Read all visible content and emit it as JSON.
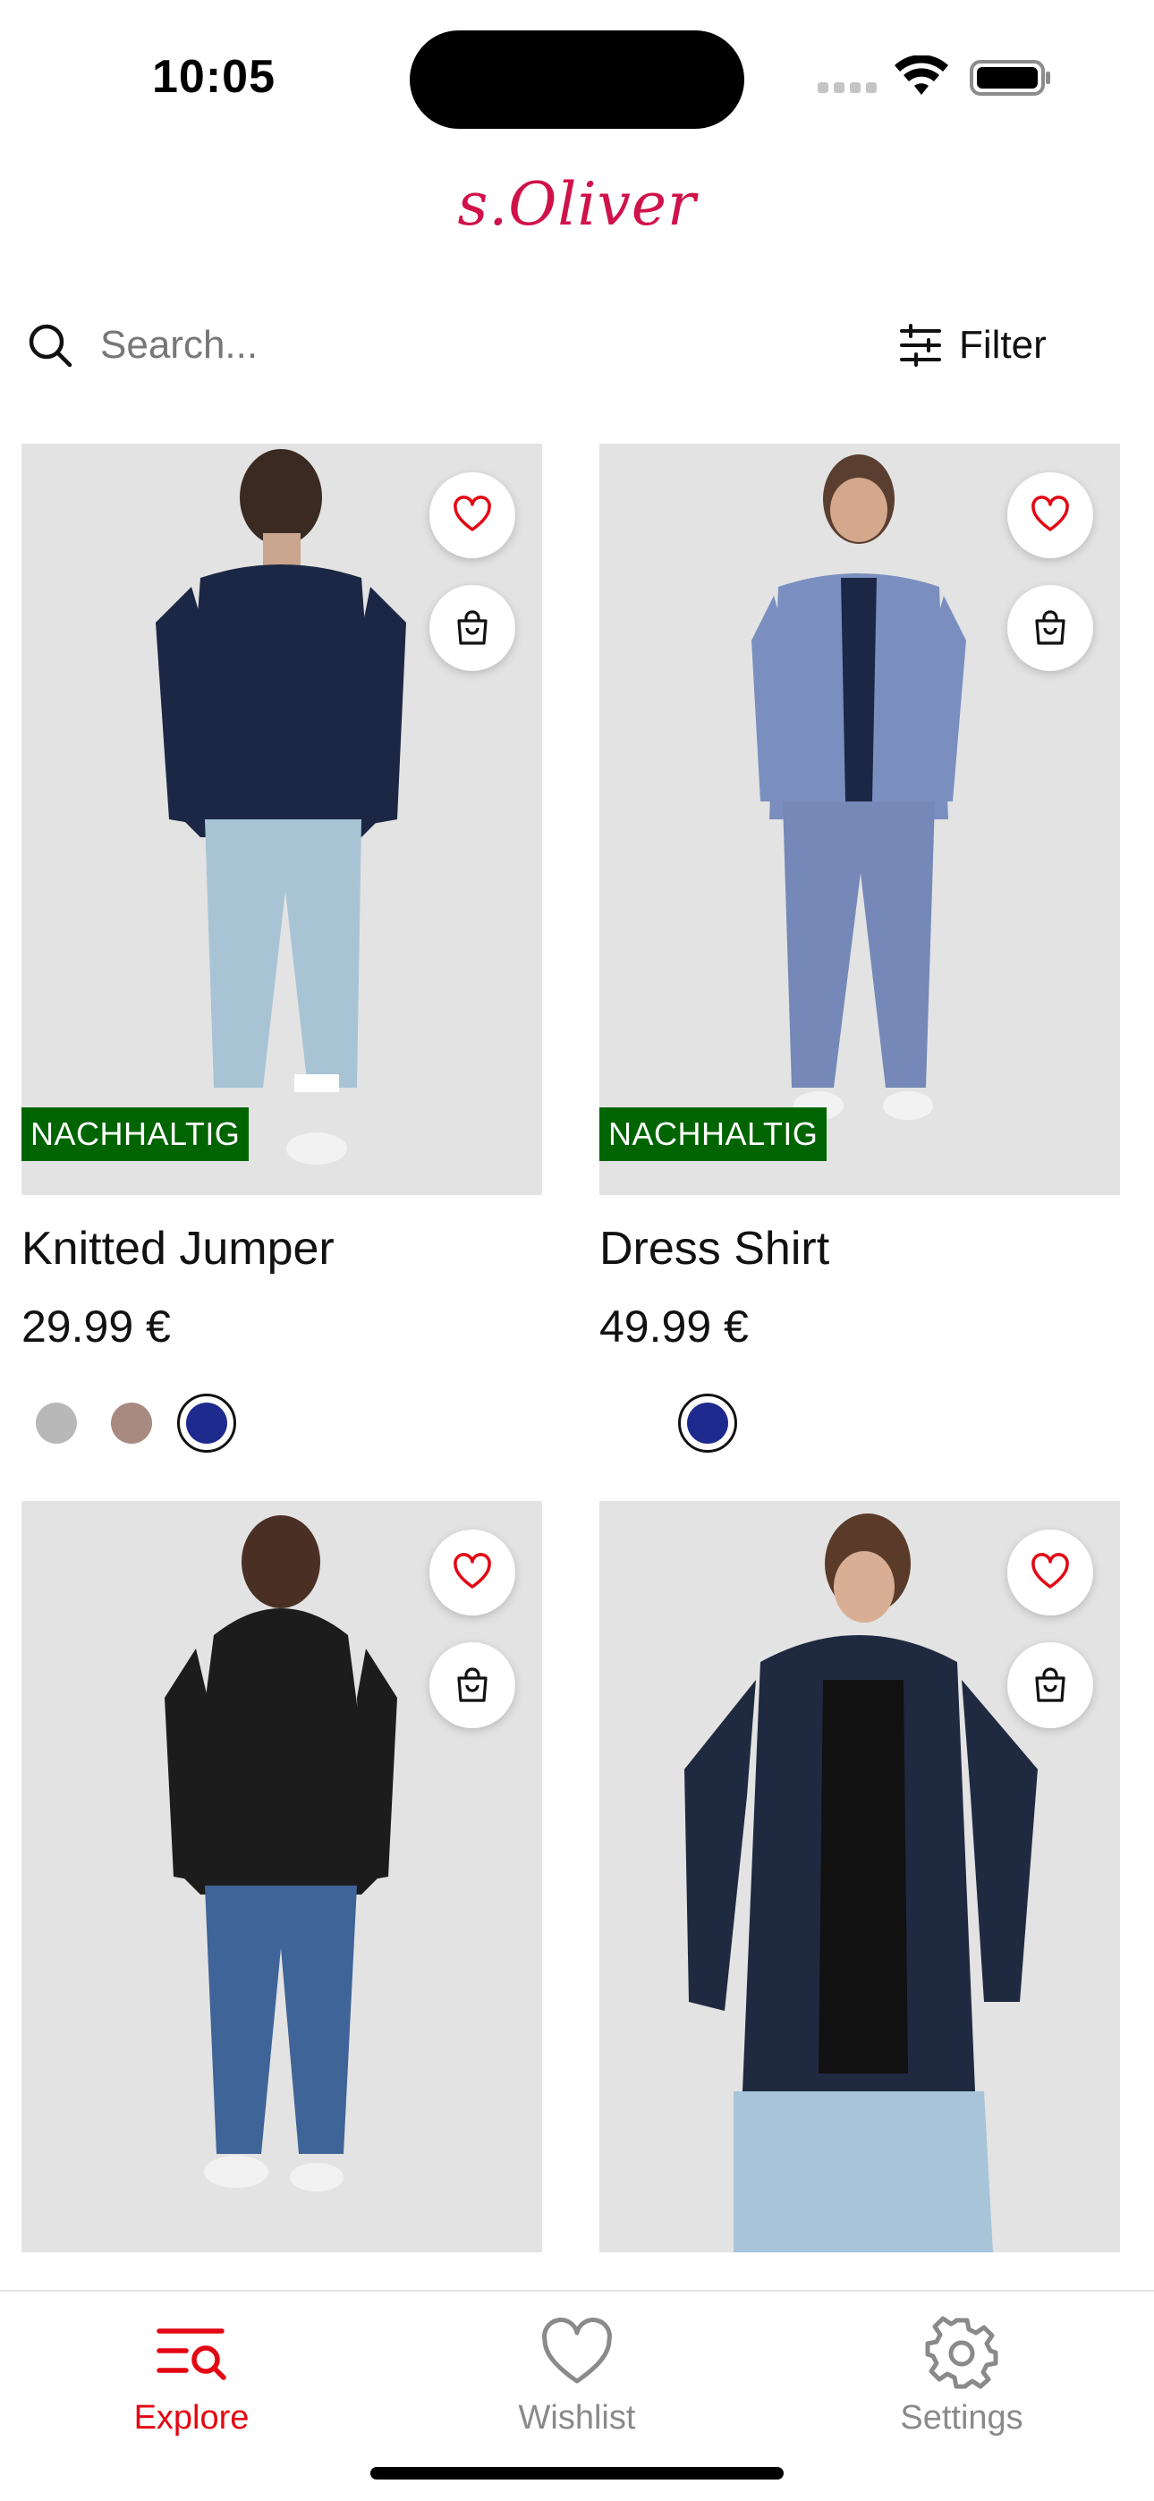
{
  "status_bar": {
    "time": "10:05"
  },
  "header": {
    "logo_text": "s.Oliver",
    "brand_color": "#d0124a"
  },
  "search": {
    "placeholder": "Search...",
    "value": "",
    "filter_label": "Filter"
  },
  "products": [
    {
      "name": "Knitted Jumper",
      "price": "29.99 €",
      "badge": "NACHHALTIG",
      "swatches": [
        "#b8b8b8",
        "#a88a80",
        "#1f2a8e"
      ],
      "selected_swatch": 2
    },
    {
      "name": "Dress Shirt",
      "price": "49.99 €",
      "badge": "NACHHALTIG",
      "swatches": [
        "#1f2a8e"
      ],
      "selected_swatch": 0
    },
    {
      "name": "",
      "price": "",
      "badge": ""
    },
    {
      "name": "",
      "price": "",
      "badge": ""
    }
  ],
  "colors": {
    "badge_green": "#006400",
    "accent_red": "#e30613",
    "image_bg": "#e3e3e3"
  },
  "tabs": [
    {
      "label": "Explore",
      "icon": "explore-icon",
      "active": true
    },
    {
      "label": "Wishlist",
      "icon": "heart-icon",
      "active": false
    },
    {
      "label": "Settings",
      "icon": "gear-icon",
      "active": false
    }
  ]
}
